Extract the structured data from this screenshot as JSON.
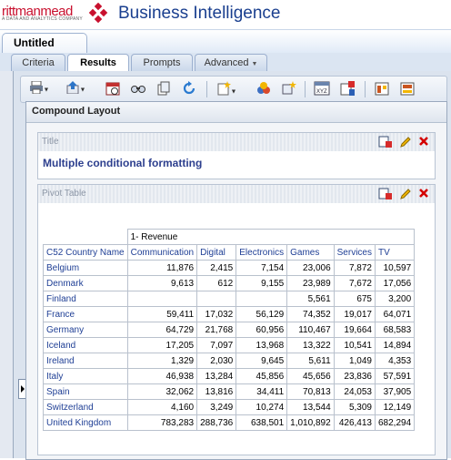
{
  "app": {
    "logo_brand": "rittmanmead",
    "logo_tagline": "A DATA AND ANALYTICS COMPANY",
    "title": "Business Intelligence"
  },
  "document_tab": {
    "label": "Untitled"
  },
  "subtabs": [
    {
      "label": "Criteria",
      "active": false,
      "has_menu": false
    },
    {
      "label": "Results",
      "active": true,
      "has_menu": false
    },
    {
      "label": "Prompts",
      "active": false,
      "has_menu": false
    },
    {
      "label": "Advanced",
      "active": false,
      "has_menu": true
    }
  ],
  "toolbar": {
    "buttons": [
      {
        "icon": "print-icon",
        "has_menu": true
      },
      {
        "icon": "export-icon",
        "has_menu": true
      },
      {
        "icon": "schedule-icon",
        "has_menu": false
      },
      {
        "icon": "preview-icon",
        "has_menu": false
      },
      {
        "icon": "copy-icon",
        "has_menu": false
      },
      {
        "icon": "refresh-icon",
        "has_menu": false
      },
      {
        "icon": "new-view-icon",
        "has_menu": true
      },
      {
        "icon": "view-selector-icon",
        "has_menu": false
      },
      {
        "icon": "add-view-icon",
        "has_menu": false
      },
      {
        "icon": "format-table-icon",
        "has_menu": false
      },
      {
        "icon": "properties-icon",
        "has_menu": false
      },
      {
        "icon": "layout-icon",
        "has_menu": false
      },
      {
        "icon": "compound-layout-icon",
        "has_menu": false
      }
    ]
  },
  "compound_layout": {
    "header": "Compound Layout",
    "title_view": {
      "label": "Title",
      "text": "Multiple conditional formatting"
    },
    "pivot_view": {
      "label": "Pivot Table",
      "measure_label": "1- Revenue",
      "row_header": "C52 Country Name",
      "columns": [
        "Communication",
        "Digital",
        "Electronics",
        "Games",
        "Services",
        "TV"
      ],
      "rows": [
        {
          "country": "Belgium",
          "values": [
            "11,876",
            "2,415",
            "7,154",
            "23,006",
            "7,872",
            "10,597"
          ]
        },
        {
          "country": "Denmark",
          "values": [
            "9,613",
            "612",
            "9,155",
            "23,989",
            "7,672",
            "17,056"
          ]
        },
        {
          "country": "Finland",
          "values": [
            "",
            "",
            "",
            "5,561",
            "675",
            "3,200"
          ]
        },
        {
          "country": "France",
          "values": [
            "59,411",
            "17,032",
            "56,129",
            "74,352",
            "19,017",
            "64,071"
          ]
        },
        {
          "country": "Germany",
          "values": [
            "64,729",
            "21,768",
            "60,956",
            "110,467",
            "19,664",
            "68,583"
          ]
        },
        {
          "country": "Iceland",
          "values": [
            "17,205",
            "7,097",
            "13,968",
            "13,322",
            "10,541",
            "14,894"
          ]
        },
        {
          "country": "Ireland",
          "values": [
            "1,329",
            "2,030",
            "9,645",
            "5,611",
            "1,049",
            "4,353"
          ]
        },
        {
          "country": "Italy",
          "values": [
            "46,938",
            "13,284",
            "45,856",
            "45,656",
            "23,836",
            "57,591"
          ]
        },
        {
          "country": "Spain",
          "values": [
            "32,062",
            "13,816",
            "34,411",
            "70,813",
            "24,053",
            "37,905"
          ]
        },
        {
          "country": "Switzerland",
          "values": [
            "4,160",
            "3,249",
            "10,274",
            "13,544",
            "5,309",
            "12,149"
          ]
        },
        {
          "country": "United Kingdom",
          "values": [
            "783,283",
            "288,736",
            "638,501",
            "1,010,892",
            "426,413",
            "682,294"
          ]
        }
      ]
    }
  },
  "colors": {
    "brand_red": "#c8102e",
    "title_blue": "#1a3f8f",
    "link_blue": "#1f3f95",
    "delete_red": "#d40000",
    "edit_yellow": "#e0a100"
  }
}
